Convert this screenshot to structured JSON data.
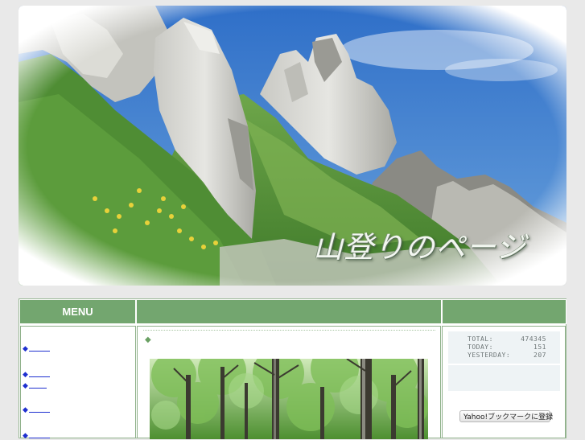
{
  "header": {
    "title": "山登りのページ"
  },
  "columns": {
    "menu_heading": "MENU",
    "center_heading": "",
    "right_heading": ""
  },
  "menu": {
    "items": [
      {
        "marker": "◆",
        "label": ""
      },
      {
        "marker": "◆",
        "label": ""
      },
      {
        "marker": "◆",
        "label": ""
      },
      {
        "marker": "◆",
        "label": ""
      },
      {
        "marker": "◆",
        "label": ""
      }
    ]
  },
  "main": {
    "marker": "◆"
  },
  "counter": {
    "total_label": "TOTAL:",
    "total_value": "474345",
    "today_label": "TODAY:",
    "today_value": "151",
    "yesterday_label": "YESTERDAY:",
    "yesterday_value": "207"
  },
  "bookmark": {
    "label": "Yahoo!ブックマークに登録"
  },
  "colors": {
    "header_green": "#73a66f",
    "link_blue": "#1e2fd0",
    "sky_blue": "#3f7fd0"
  }
}
